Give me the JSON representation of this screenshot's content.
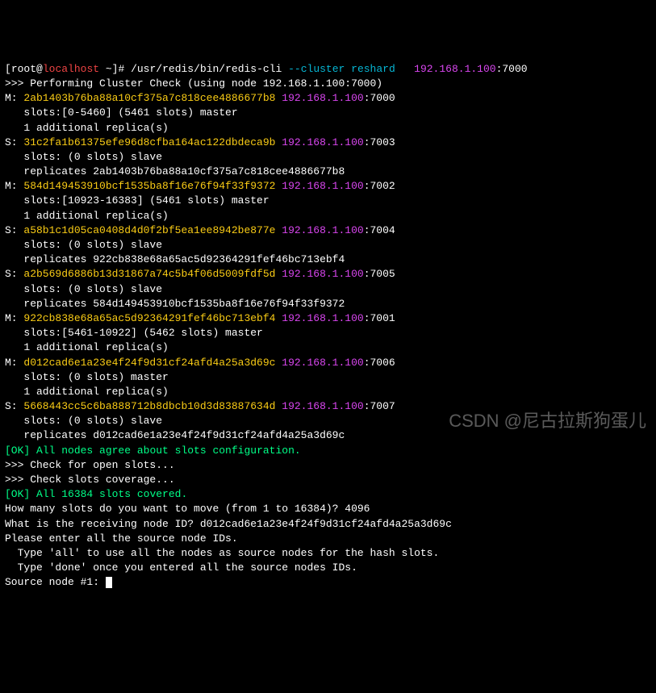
{
  "prompt": {
    "bracket_open": "[",
    "user": "root",
    "at": "@",
    "host": "localhost",
    "path": " ~",
    "bracket_close": "]#",
    "cmd_bin": " /usr/redis/bin/redis-cli ",
    "cmd_flag": "--cluster reshard",
    "space": "   ",
    "ip": "192.168.1.100",
    "port": ":7000"
  },
  "header": {
    "line1a": ">>> Performing Cluster Check (using node 192.168.1.100:7000)"
  },
  "nodes": [
    {
      "prefix": "M: ",
      "id": "2ab1403b76ba88a10cf375a7c818cee4886677b8 ",
      "ip": "192.168.1.100",
      "port": ":7000",
      "slots": "   slots:[0-5460] (5461 slots) master",
      "extra": "   1 additional replica(s)"
    },
    {
      "prefix": "S: ",
      "id": "31c2fa1b61375efe96d8cfba164ac122dbdeca9b ",
      "ip": "192.168.1.100",
      "port": ":7003",
      "slots": "   slots: (0 slots) slave",
      "extra": "   replicates 2ab1403b76ba88a10cf375a7c818cee4886677b8"
    },
    {
      "prefix": "M: ",
      "id": "584d149453910bcf1535ba8f16e76f94f33f9372 ",
      "ip": "192.168.1.100",
      "port": ":7002",
      "slots": "   slots:[10923-16383] (5461 slots) master",
      "extra": "   1 additional replica(s)"
    },
    {
      "prefix": "S: ",
      "id": "a58b1c1d05ca0408d4d0f2bf5ea1ee8942be877e ",
      "ip": "192.168.1.100",
      "port": ":7004",
      "slots": "   slots: (0 slots) slave",
      "extra": "   replicates 922cb838e68a65ac5d92364291fef46bc713ebf4"
    },
    {
      "prefix": "S: ",
      "id": "a2b569d6886b13d31867a74c5b4f06d5009fdf5d ",
      "ip": "192.168.1.100",
      "port": ":7005",
      "slots": "   slots: (0 slots) slave",
      "extra": "   replicates 584d149453910bcf1535ba8f16e76f94f33f9372"
    },
    {
      "prefix": "M: ",
      "id": "922cb838e68a65ac5d92364291fef46bc713ebf4 ",
      "ip": "192.168.1.100",
      "port": ":7001",
      "slots": "   slots:[5461-10922] (5462 slots) master",
      "extra": "   1 additional replica(s)"
    },
    {
      "prefix": "M: ",
      "id": "d012cad6e1a23e4f24f9d31cf24afd4a25a3d69c ",
      "ip": "192.168.1.100",
      "port": ":7006",
      "slots": "   slots: (0 slots) master",
      "extra": "   1 additional replica(s)"
    },
    {
      "prefix": "S: ",
      "id": "5668443cc5c6ba888712b8dbcb10d3d83887634d ",
      "ip": "192.168.1.100",
      "port": ":7007",
      "slots": "   slots: (0 slots) slave",
      "extra": "   replicates d012cad6e1a23e4f24f9d31cf24afd4a25a3d69c"
    }
  ],
  "ok1": {
    "ok": "[OK]",
    "msg": " All nodes agree about slots configuration."
  },
  "check1": ">>> Check for open slots...",
  "check2": ">>> Check slots coverage...",
  "ok2": {
    "ok": "[OK]",
    "msg": " All 16384 slots covered."
  },
  "questions": {
    "q1": "How many slots do you want to move (from 1 to 16384)? 4096",
    "q2": "What is the receiving node ID? d012cad6e1a23e4f24f9d31cf24afd4a25a3d69c",
    "q3": "Please enter all the source node IDs.",
    "q4": "  Type 'all' to use all the nodes as source nodes for the hash slots.",
    "q5": "  Type 'done' once you entered all the source nodes IDs.",
    "q6": "Source node #1: "
  },
  "watermark": "CSDN @尼古拉斯狗蛋儿"
}
